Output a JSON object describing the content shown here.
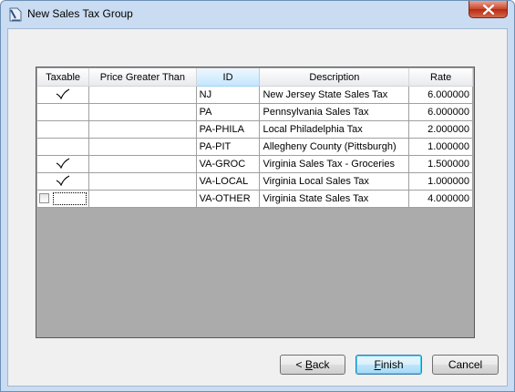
{
  "window": {
    "title": "New Sales Tax Group",
    "icon": "doc-pencil-icon",
    "close_icon": "close-icon"
  },
  "grid": {
    "columns": [
      "Taxable",
      "Price Greater Than",
      "ID",
      "Description",
      "Rate"
    ],
    "selected_column": "ID",
    "rows": [
      {
        "taxable": true,
        "price": "",
        "id": "NJ",
        "description": "New Jersey State Sales Tax",
        "rate": "6.000000"
      },
      {
        "taxable": false,
        "price": "",
        "id": "PA",
        "description": "Pennsylvania Sales Tax",
        "rate": "6.000000"
      },
      {
        "taxable": false,
        "price": "",
        "id": "PA-PHILA",
        "description": "Local Philadelphia Tax",
        "rate": "2.000000"
      },
      {
        "taxable": false,
        "price": "",
        "id": "PA-PIT",
        "description": "Allegheny County (Pittsburgh)",
        "rate": "1.000000"
      },
      {
        "taxable": true,
        "price": "",
        "id": "VA-GROC",
        "description": "Virginia Sales Tax - Groceries",
        "rate": "1.500000"
      },
      {
        "taxable": true,
        "price": "",
        "id": "VA-LOCAL",
        "description": "Virginia Local Sales Tax",
        "rate": "1.000000"
      },
      {
        "taxable": false,
        "price": "",
        "id": "VA-OTHER",
        "description": "Virginia State Sales Tax",
        "rate": "4.000000",
        "editing": true
      }
    ]
  },
  "buttons": {
    "back": {
      "prefix": "< ",
      "mnemonic": "B",
      "rest": "ack"
    },
    "finish": {
      "mnemonic": "F",
      "rest": "inish"
    },
    "cancel": {
      "label": "Cancel"
    }
  }
}
